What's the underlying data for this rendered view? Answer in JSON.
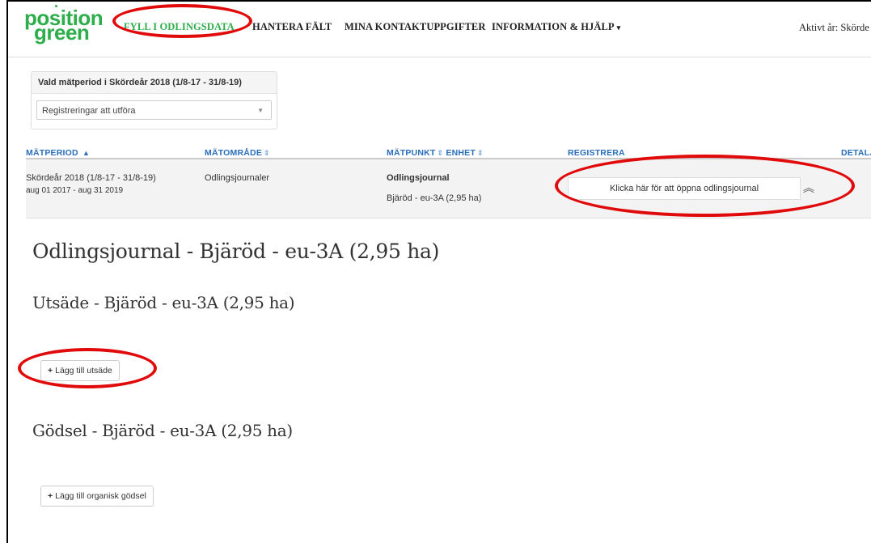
{
  "logo": {
    "line1": "position",
    "line2": "green"
  },
  "nav": {
    "fyll": "FYLL I ODLINGSDATA",
    "hantera": "HANTERA FÄLT",
    "kontakt": "MINA KONTAKTUPPGIFTER",
    "info": "INFORMATION & HJÄLP",
    "info_caret": "▾",
    "aktivt": "Aktivt år: Skörde"
  },
  "period": {
    "heading": "Vald mätperiod i Skördeår 2018 (1/8-17 - 31/8-19)",
    "select_value": "Registreringar att utföra",
    "select_arrow": "▼"
  },
  "table": {
    "headers": {
      "matperiod": "MÄTPERIOD",
      "matomrade": "MÄTOMRÅDE",
      "matpunkt": "MÄTPUNKT",
      "enhet": "ENHET",
      "registrera": "REGISTRERA",
      "detalj": "DETALJ"
    },
    "sort_asc": "▲",
    "sort_both": "⇕",
    "row": {
      "period": "Skördeår 2018 (1/8-17 - 31/8-19)",
      "dates": "aug 01 2017 - aug 31 2019",
      "area": "Odlingsjournaler",
      "point": "Odlingsjournal",
      "unit": "Bjäröd - eu-3A (2,95 ha)",
      "register_button": "Klicka här för att öppna odlingsjournal",
      "collapse_glyph": "︽"
    }
  },
  "journal": {
    "title": "Odlingsjournal - Bjäröd - eu-3A (2,95 ha)",
    "utsade_heading": "Utsäde - Bjäröd - eu-3A (2,95 ha)",
    "add_utsade": "Lägg till utsäde",
    "godsel_heading": "Gödsel - Bjäröd - eu-3A (2,95 ha)",
    "add_godsel": "Lägg till organisk gödsel",
    "plus": "+"
  },
  "colors": {
    "brand_green": "#2eae4b",
    "link_blue": "#2a6ebb",
    "annotation_red": "#e10a0a"
  }
}
